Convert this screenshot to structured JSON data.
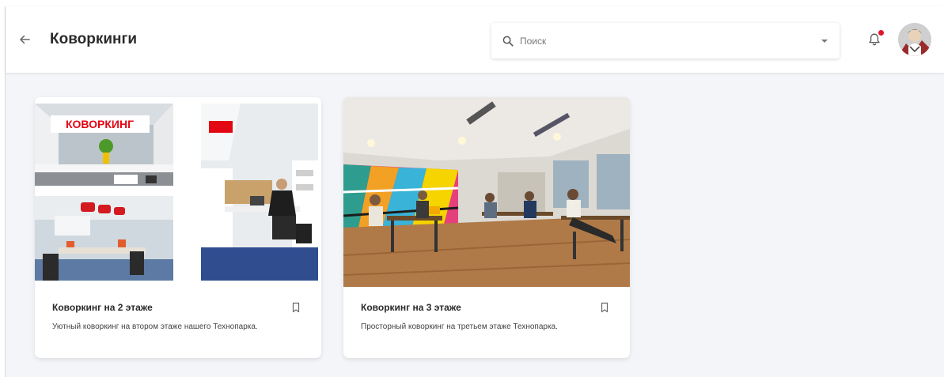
{
  "header": {
    "title": "Коворкинги",
    "search": {
      "placeholder": "Поиск",
      "value": ""
    },
    "has_notification": true
  },
  "cards": [
    {
      "title": "Коворкинг на 2 этаже",
      "description": "Уютный коворкинг на втором этаже нашего Технопарка.",
      "sign_text": "КОВОРКИНГ"
    },
    {
      "title": "Коворкинг на 3 этаже",
      "description": "Просторный коворкинг на третьем этаже Технопарка."
    }
  ],
  "colors": {
    "background": "#f3f5f8",
    "header": "#ffffff",
    "notification_dot": "#e0162b",
    "sign": "#e30613"
  }
}
